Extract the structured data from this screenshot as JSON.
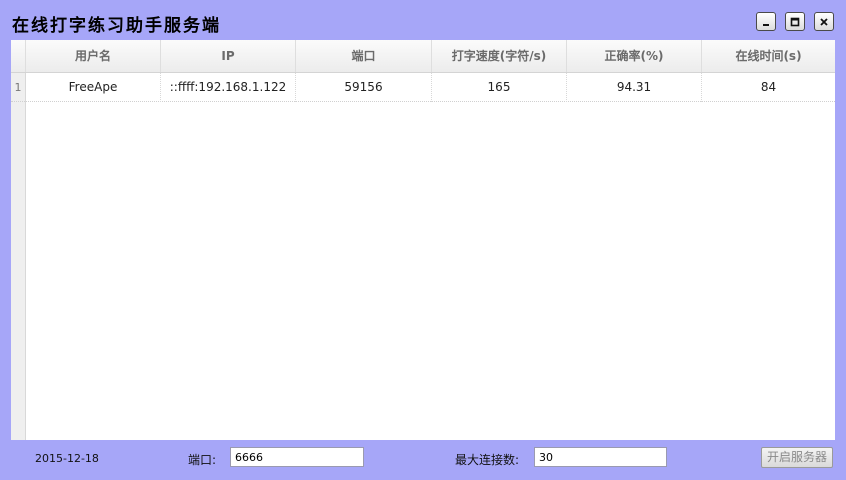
{
  "window": {
    "title": "在线打字练习助手服务端",
    "icons": {
      "minimize": "minimize-icon",
      "maximize": "maximize-icon",
      "close": "close-icon"
    }
  },
  "table": {
    "columns": [
      "用户名",
      "IP",
      "端口",
      "打字速度(字符/s)",
      "正确率(%)",
      "在线时间(s)"
    ],
    "rows": [
      {
        "index": "1",
        "cells": [
          "FreeApe",
          "::ffff:192.168.1.122",
          "59156",
          "165",
          "94.31",
          "84"
        ]
      }
    ]
  },
  "footer": {
    "date": "2015-12-18",
    "port_label": "端口:",
    "port_value": "6666",
    "max_conn_label": "最大连接数:",
    "max_conn_value": "30",
    "start_button": "开启服务器"
  }
}
